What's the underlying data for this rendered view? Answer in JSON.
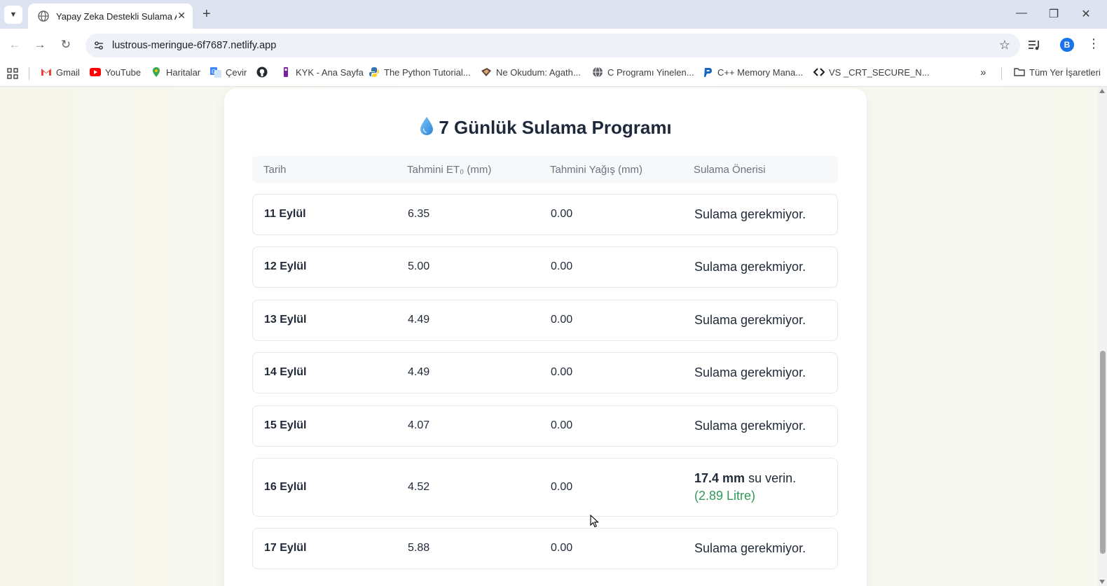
{
  "browser": {
    "tab_title": "Yapay Zeka Destekli Sulama Asistanı",
    "url": "lustrous-meringue-6f7687.netlify.app",
    "profile_initial": "B",
    "bookmarks": [
      {
        "label": "Gmail",
        "icon": "gmail-icon"
      },
      {
        "label": "YouTube",
        "icon": "youtube-icon"
      },
      {
        "label": "Haritalar",
        "icon": "maps-icon"
      },
      {
        "label": "Çevir",
        "icon": "translate-icon"
      },
      {
        "label": "",
        "icon": "github-icon"
      },
      {
        "label": "KYK - Ana Sayfa",
        "icon": "kyk-icon"
      },
      {
        "label": "The Python Tutorial...",
        "icon": "python-icon"
      },
      {
        "label": "Ne Okudum: Agath...",
        "icon": "book-icon"
      },
      {
        "label": "C Programı Yinelen...",
        "icon": "globe-icon"
      },
      {
        "label": "C++ Memory Mana...",
        "icon": "p-icon"
      },
      {
        "label": "VS _CRT_SECURE_N...",
        "icon": "code-icon"
      }
    ],
    "all_bookmarks_label": "Tüm Yer İşaretleri"
  },
  "schedule": {
    "title": "7 Günlük Sulama Programı",
    "headers": [
      "Tarih",
      "Tahmini ET₀ (mm)",
      "Tahmini Yağış (mm)",
      "Sulama Önerisi"
    ],
    "rows": [
      {
        "date": "11 Eylül",
        "et0": "6.35",
        "rain": "0.00",
        "advice": "Sulama gerekmiyor."
      },
      {
        "date": "12 Eylül",
        "et0": "5.00",
        "rain": "0.00",
        "advice": "Sulama gerekmiyor."
      },
      {
        "date": "13 Eylül",
        "et0": "4.49",
        "rain": "0.00",
        "advice": "Sulama gerekmiyor."
      },
      {
        "date": "14 Eylül",
        "et0": "4.49",
        "rain": "0.00",
        "advice": "Sulama gerekmiyor."
      },
      {
        "date": "15 Eylül",
        "et0": "4.07",
        "rain": "0.00",
        "advice": "Sulama gerekmiyor."
      },
      {
        "date": "16 Eylül",
        "et0": "4.52",
        "rain": "0.00",
        "advice_amount": "17.4 mm",
        "advice_text": "su verin.",
        "advice_litre": "(2.89 Litre)"
      },
      {
        "date": "17 Eylül",
        "et0": "5.88",
        "rain": "0.00",
        "advice": "Sulama gerekmiyor."
      }
    ]
  },
  "colors": {
    "accent_green": "#2f9a5a",
    "drop_blue": "#3b9ae1",
    "chrome_tab_bg": "#dde3f0"
  }
}
